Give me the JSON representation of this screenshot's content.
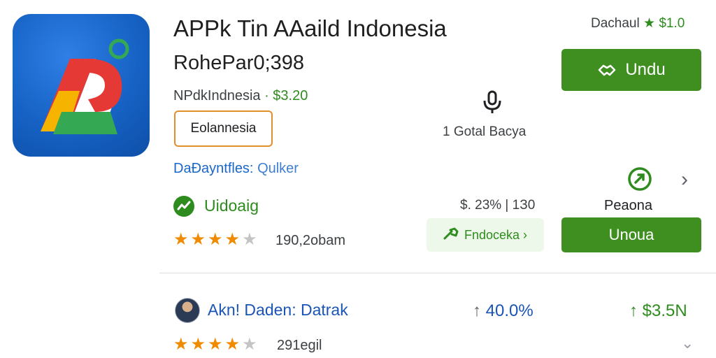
{
  "app": {
    "title": "APPk Tin AАaild Indonesia",
    "subtitle": "RohePar0;398",
    "developer": "NPdkIndnesia",
    "developer_price": "· $3.20",
    "tag": "Eolannesia",
    "category_label": "DaÐayntfles:",
    "category_value": "Qulker",
    "status_label": "Uidoaig"
  },
  "top_right": {
    "label": "Dachaul",
    "star": "★",
    "value": "$1.0"
  },
  "install_button": {
    "label": "Undu",
    "icon": "handshake-icon"
  },
  "mic": {
    "icon": "microphone-icon",
    "text": "1 Gotal Bacya"
  },
  "share": {
    "icon": "share-icon",
    "label": "Peaona",
    "chevron": "›"
  },
  "stats": {
    "text": "$. 23% | 1З0"
  },
  "chip": {
    "icon": "wrench-icon",
    "label": "Fndoceka ›"
  },
  "secondary_button": {
    "label": "Unoua"
  },
  "rating1": {
    "stars_on": "★★★★",
    "stars_off": "★",
    "text": "190,2obam"
  },
  "review": {
    "author": "Akn! Daden: Datrak",
    "growth_arrow": "↑",
    "growth": "40.0%",
    "revenue_arrow": "↑",
    "revenue": "$3.5N",
    "stars_on": "★★★★",
    "stars_off": "★",
    "count": "291egil",
    "chevron": "⌄"
  },
  "colors": {
    "accent_green": "#3e8f1f",
    "link_blue": "#1a66c9",
    "star_orange": "#f08a00",
    "tag_border": "#e0902b"
  }
}
